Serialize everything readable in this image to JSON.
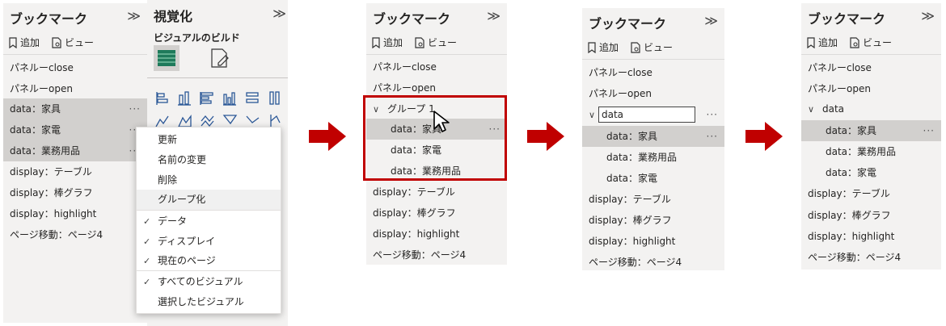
{
  "pane1": {
    "title": "ブックマーク",
    "chevron": "≫",
    "add_label": "追加",
    "view_label": "ビュー",
    "items": [
      {
        "label": "パネルーclose"
      },
      {
        "label": "パネルーopen"
      },
      {
        "label": "data：家具",
        "dots": "···"
      },
      {
        "label": "data：家電",
        "dots": "···"
      },
      {
        "label": "data：業務用品",
        "dots": "···"
      },
      {
        "label": "display：テーブル"
      },
      {
        "label": "display：棒グラフ"
      },
      {
        "label": "display：highlight"
      },
      {
        "label": "ページ移動：ページ4"
      }
    ]
  },
  "viz": {
    "title": "視覚化",
    "chevron": "≫",
    "build_label": "ビジュアルのビルド"
  },
  "menu": {
    "items": [
      {
        "label": "更新"
      },
      {
        "label": "名前の変更"
      },
      {
        "label": "削除"
      },
      {
        "label": "グループ化"
      },
      {
        "label": "データ",
        "check": "✓"
      },
      {
        "label": "ディスプレイ",
        "check": "✓"
      },
      {
        "label": "現在のページ",
        "check": "✓"
      },
      {
        "label": "すべてのビジュアル",
        "check": "✓"
      },
      {
        "label": "選択したビジュアル"
      }
    ]
  },
  "pane2": {
    "title": "ブックマーク",
    "chevron": "≫",
    "add_label": "追加",
    "view_label": "ビュー",
    "items": [
      {
        "label": "パネルーclose"
      },
      {
        "label": "パネルーopen"
      },
      {
        "label": "グループ 1",
        "caret": "∨"
      },
      {
        "label": "data：家具",
        "dots": "···"
      },
      {
        "label": "data：家電"
      },
      {
        "label": "data：業務用品"
      },
      {
        "label": "display：テーブル"
      },
      {
        "label": "display：棒グラフ"
      },
      {
        "label": "display：highlight"
      },
      {
        "label": "ページ移動：ページ4"
      }
    ]
  },
  "pane3": {
    "title": "ブックマーク",
    "chevron": "≫",
    "add_label": "追加",
    "view_label": "ビュー",
    "group_input_value": "data",
    "group_dots": "···",
    "caret": "∨",
    "items": [
      {
        "label": "パネルーclose"
      },
      {
        "label": "パネルーopen"
      },
      {
        "label": "data：家具",
        "dots": "···"
      },
      {
        "label": "data：業務用品"
      },
      {
        "label": "data：家電"
      },
      {
        "label": "display：テーブル"
      },
      {
        "label": "display：棒グラフ"
      },
      {
        "label": "display：highlight"
      },
      {
        "label": "ページ移動：ページ4"
      }
    ]
  },
  "pane4": {
    "title": "ブックマーク",
    "chevron": "≫",
    "add_label": "追加",
    "view_label": "ビュー",
    "items": [
      {
        "label": "パネルーclose"
      },
      {
        "label": "パネルーopen"
      },
      {
        "label": "data",
        "caret": "∨"
      },
      {
        "label": "data：家具",
        "dots": "···"
      },
      {
        "label": "data：業務用品"
      },
      {
        "label": "data：家電"
      },
      {
        "label": "display：テーブル"
      },
      {
        "label": "display：棒グラフ"
      },
      {
        "label": "display：highlight"
      },
      {
        "label": "ページ移動：ページ4"
      }
    ]
  },
  "colors": {
    "arrow": "#c00000",
    "highlight_box": "#c00000",
    "selected_row": "#d2d0ce",
    "pane_bg": "#f3f2f1"
  }
}
